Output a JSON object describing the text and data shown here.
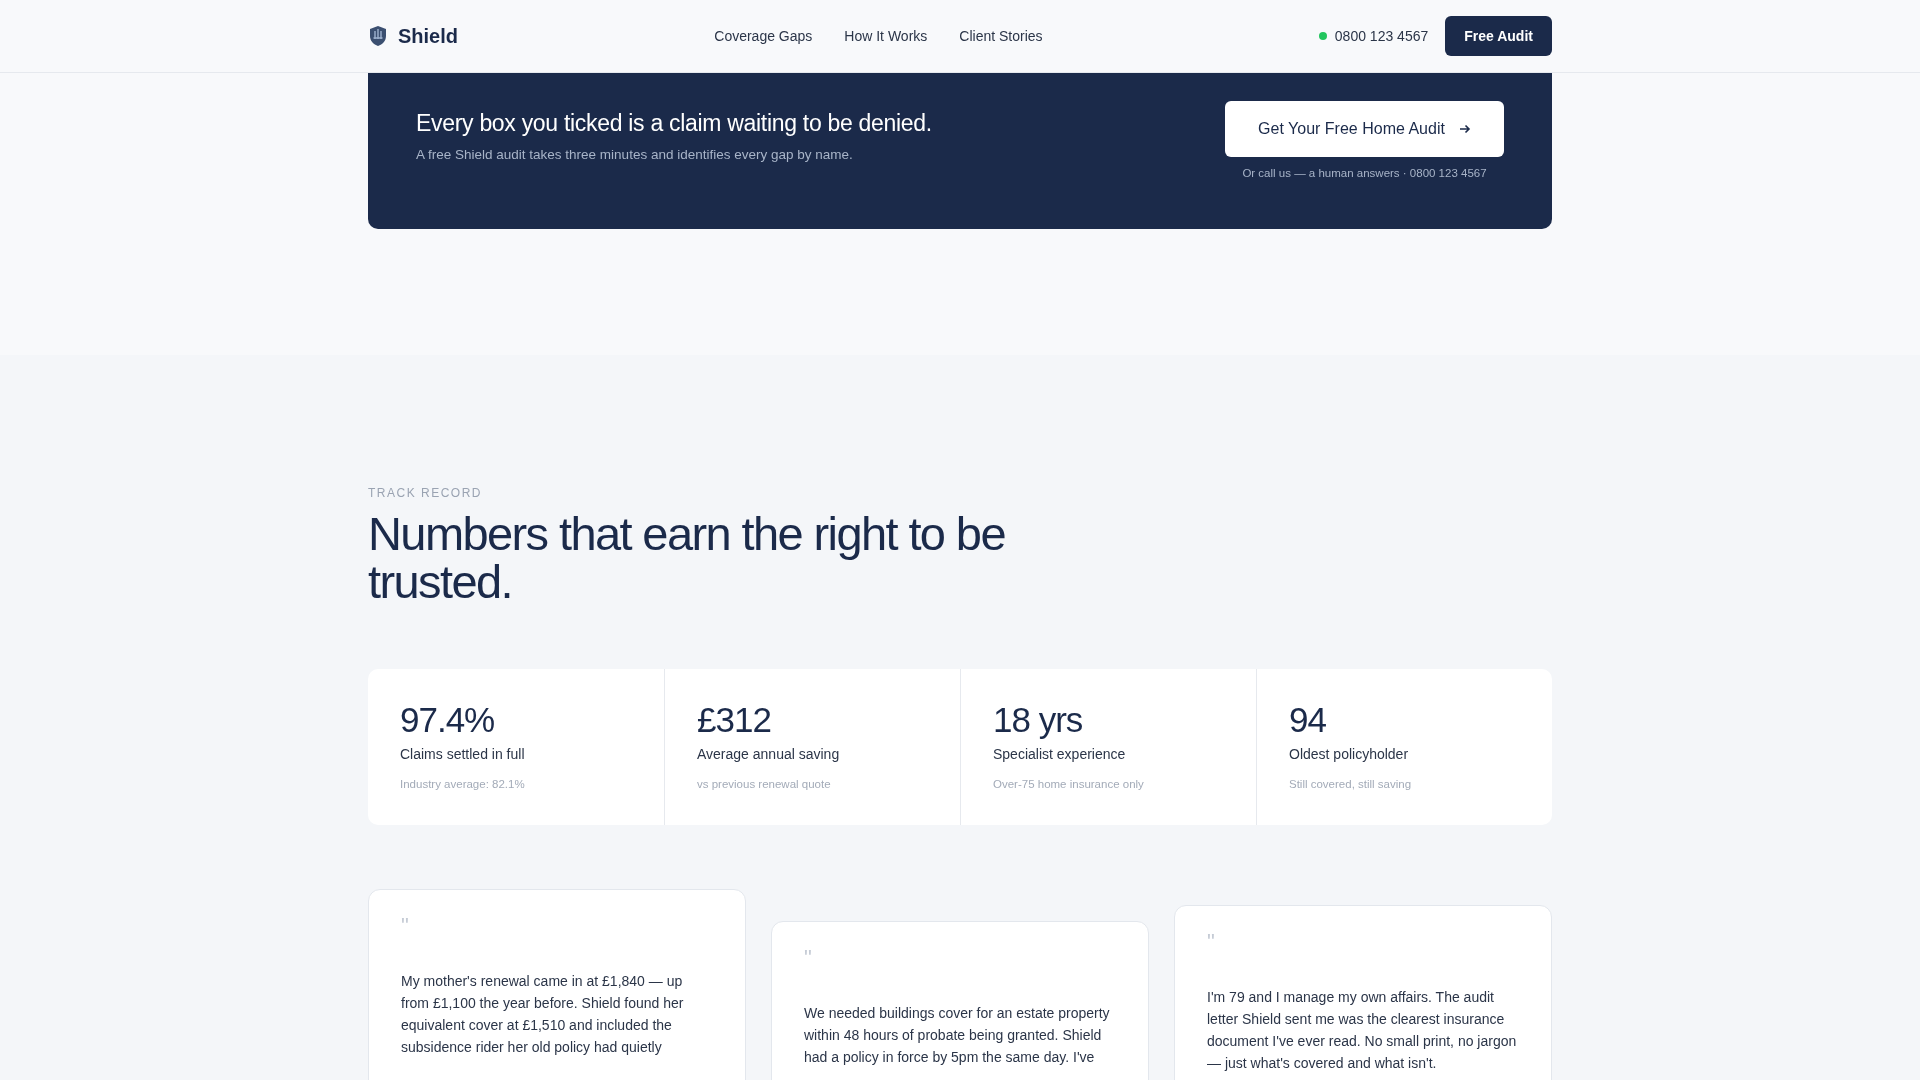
{
  "header": {
    "brand": "Shield",
    "nav": [
      {
        "label": "Coverage Gaps"
      },
      {
        "label": "How It Works"
      },
      {
        "label": "Client Stories"
      }
    ],
    "phone": "0800 123 4567",
    "cta": "Free Audit"
  },
  "banner": {
    "headline": "Every box you ticked is a claim waiting to be denied.",
    "subtext": "A free Shield audit takes three minutes and identifies every gap by name.",
    "button": "Get Your Free Home Audit",
    "note": "Or call us — a human answers · 0800 123 4567"
  },
  "track_record": {
    "eyebrow": "TRACK RECORD",
    "heading": "Numbers that earn the right to be trusted.",
    "stats": [
      {
        "value": "97.4%",
        "label": "Claims settled in full",
        "note": "Industry average: 82.1%"
      },
      {
        "value": "£312",
        "label": "Average annual saving",
        "note": "vs previous renewal quote"
      },
      {
        "value": "18 yrs",
        "label": "Specialist experience",
        "note": "Over-75 home insurance only"
      },
      {
        "value": "94",
        "label": "Oldest policyholder",
        "note": "Still covered, still saving"
      }
    ],
    "testimonials": [
      {
        "mark": "\"",
        "quote": "My mother's renewal came in at £1,840 — up from £1,100 the year before. Shield found her equivalent cover at £1,510 and included the subsidence rider her old policy had quietly"
      },
      {
        "mark": "\"",
        "quote": "We needed buildings cover for an estate property within 48 hours of probate being granted. Shield had a policy in force by 5pm the same day. I've"
      },
      {
        "mark": "\"",
        "quote": "I'm 79 and I manage my own affairs. The audit letter Shield sent me was the clearest insurance document I've ever read. No small print, no jargon — just what's covered and what isn't."
      }
    ]
  }
}
